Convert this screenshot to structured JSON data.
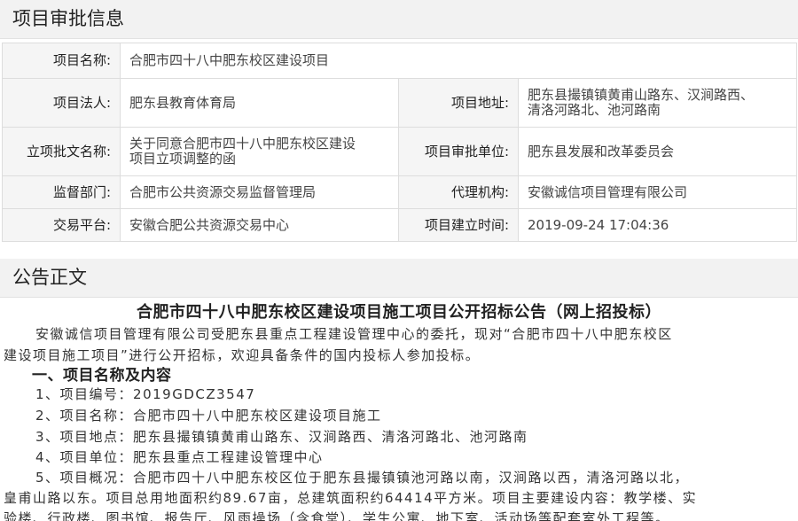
{
  "section1": {
    "title": "项目审批信息"
  },
  "info": {
    "project_name_label": "项目名称:",
    "project_name": "合肥市四十八中肥东校区建设项目",
    "legal_person_label": "项目法人:",
    "legal_person": "肥东县教育体育局",
    "address_label": "项目地址:",
    "address_line1": "肥东县撮镇镇黄甫山路东、汉涧路西、",
    "address_line2": "清洛河路北、池河路南",
    "approval_doc_label": "立项批文名称:",
    "approval_doc_line1": "关于同意合肥市四十八中肥东校区建设",
    "approval_doc_line2": "项目立项调整的函",
    "approval_unit_label": "项目审批单位:",
    "approval_unit": "肥东县发展和改革委员会",
    "supervisor_label": "监督部门:",
    "supervisor": "合肥市公共资源交易监督管理局",
    "agency_label": "代理机构:",
    "agency": "安徽诚信项目管理有限公司",
    "platform_label": "交易平台:",
    "platform": "安徽合肥公共资源交易中心",
    "created_time_label": "项目建立时间:",
    "created_time": "2019-09-24 17:04:36"
  },
  "section2": {
    "title": "公告正文"
  },
  "notice": {
    "title": "合肥市四十八中肥东校区建设项目施工项目公开招标公告（网上招投标）",
    "intro_line1": "安徽诚信项目管理有限公司受肥东县重点工程建设管理中心的委托，现对“合肥市四十八中肥东校区",
    "intro_line2": "建设项目施工项目”进行公开招标，欢迎具备条件的国内投标人参加投标。",
    "heading1": "一、项目名称及内容",
    "item1": "1、项目编号：2019GDCZ3547",
    "item2": "2、项目名称：合肥市四十八中肥东校区建设项目施工",
    "item3": "3、项目地点：肥东县撮镇镇黄甫山路东、汉涧路西、清洛河路北、池河路南",
    "item4": "4、项目单位：肥东县重点工程建设管理中心",
    "item5_line1": "5、项目概况：合肥市四十八中肥东校区位于肥东县撮镇镇池河路以南，汉涧路以西，清洛河路以北，",
    "item5_line2": "皇甫山路以东。项目总用地面积约89.67亩，总建筑面积约64414平方米。项目主要建设内容：教学楼、实",
    "item5_line3": "验楼、行政楼、图书馆、报告厅、风雨操场（含食堂）、学生公寓、地下室、活动场等配套室外工程等。"
  }
}
